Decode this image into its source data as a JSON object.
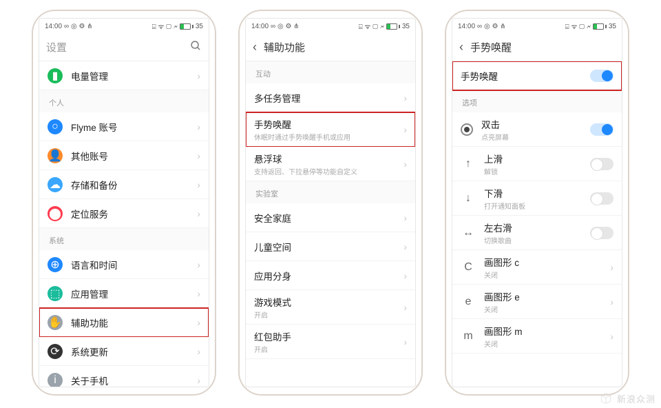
{
  "status": {
    "time": "14:00",
    "left_icons": "∞ ◎ ⚙ ⋔",
    "right_icons": "⌸ ᯤ ▢ 🗲",
    "battery": "35"
  },
  "watermark": "新浪众测",
  "phone1": {
    "search_placeholder": "设置",
    "sect_personal": "个人",
    "sect_system": "系统",
    "items": {
      "battery": "电量管理",
      "flyme": "Flyme 账号",
      "other_acct": "其他账号",
      "storage": "存储和备份",
      "location": "定位服务",
      "lang": "语言和时间",
      "apps": "应用管理",
      "access": "辅助功能",
      "update": "系统更新",
      "about": "关于手机"
    }
  },
  "phone2": {
    "title": "辅助功能",
    "sect_interact": "互动",
    "sect_lab": "实验室",
    "items": {
      "multitask": "多任务管理",
      "gesture": "手势唤醒",
      "gesture_sub": "休眠时通过手势唤醒手机或应用",
      "float": "悬浮球",
      "float_sub": "支持返回、下拉悬停等功能自定义",
      "family": "安全家庭",
      "kids": "儿童空间",
      "clone": "应用分身",
      "game": "游戏模式",
      "game_sub": "开启",
      "redpack": "红包助手",
      "redpack_sub": "开启"
    }
  },
  "phone3": {
    "title": "手势唤醒",
    "main_toggle": "手势唤醒",
    "sect_options": "选项",
    "items": {
      "dbltap": "双击",
      "dbltap_sub": "点亮屏幕",
      "up": "上滑",
      "up_sub": "解锁",
      "down": "下滑",
      "down_sub": "打开通知面板",
      "left": "左右滑",
      "left_sub": "切换歌曲",
      "drawc": "画图形 c",
      "drawc_sub": "关闭",
      "drawe": "画图形 e",
      "drawe_sub": "关闭",
      "drawm": "画图形 m",
      "drawm_sub": "关闭"
    }
  }
}
